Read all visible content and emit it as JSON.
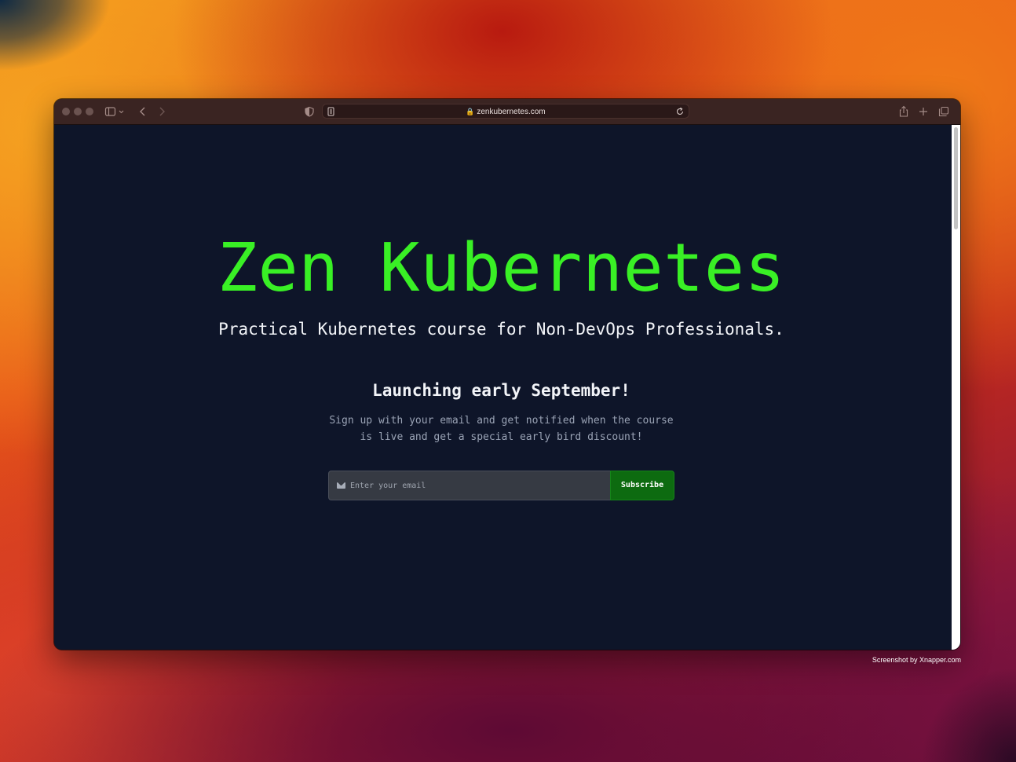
{
  "browser": {
    "url": "zenkubernetes.com",
    "icons": {
      "sidebar": "sidebar-icon",
      "back": "chevron-left-icon",
      "forward": "chevron-right-icon",
      "privacy": "shield-icon",
      "reader": "reader-icon",
      "lock": "lock-icon",
      "reload": "reload-icon",
      "share": "share-icon",
      "new_tab": "plus-icon",
      "tabs": "tabs-overview-icon"
    }
  },
  "page": {
    "title": "Zen Kubernetes",
    "subtitle": "Practical Kubernetes course for Non-DevOps Professionals.",
    "launch_heading": "Launching early September!",
    "signup_line1": "Sign up with your email and get notified when the course",
    "signup_line2": "is live and get a special early bird discount!",
    "email_placeholder": "Enter your email",
    "subscribe_label": "Subscribe"
  },
  "footer": {
    "credit": "Screenshot by Xnapper.com"
  },
  "colors": {
    "page_background": "#0e1529",
    "title_green": "#39f025",
    "subscribe_green": "#0d6b10"
  }
}
